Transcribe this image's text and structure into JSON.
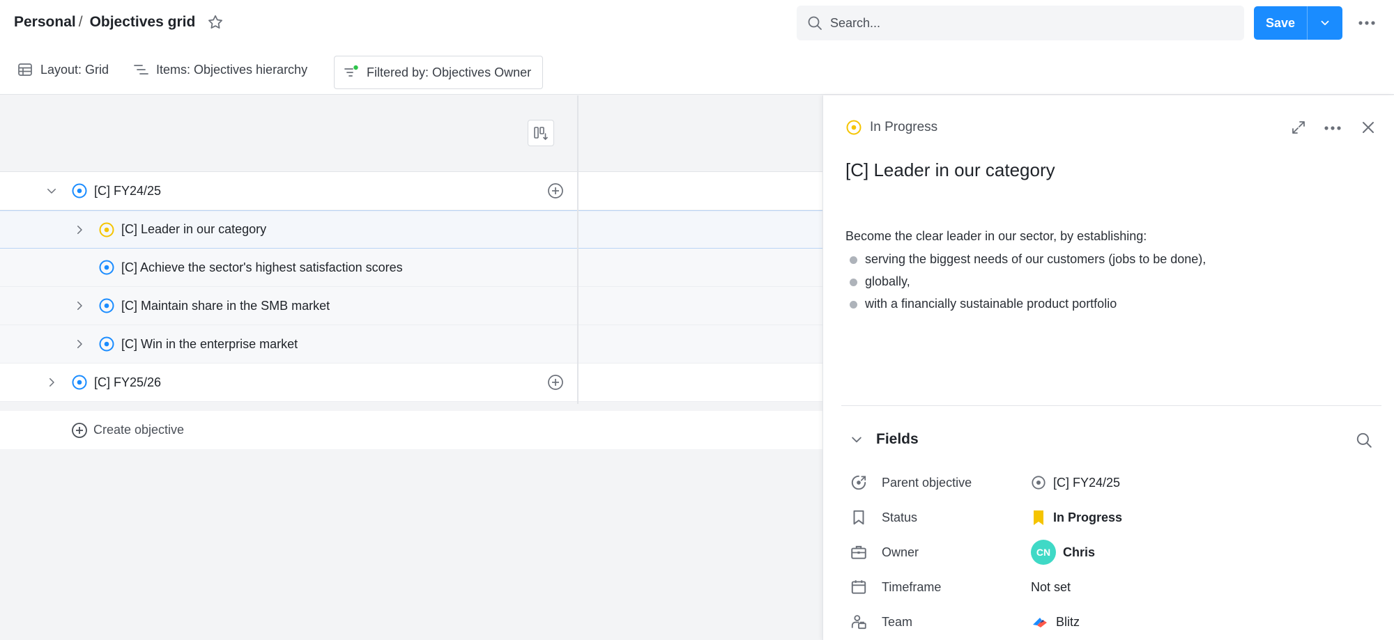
{
  "header": {
    "breadcrumb_root": "Personal",
    "breadcrumb_sep": "/",
    "page_title": "Objectives grid",
    "search_placeholder": "Search...",
    "save_label": "Save"
  },
  "toolbar": {
    "layout_label": "Layout: Grid",
    "items_label": "Items: Objectives hierarchy",
    "filter_label": "Filtered by: Objectives Owner"
  },
  "grid": {
    "rows": [
      {
        "label": "[C] FY24/25",
        "status": "in-progress-blue",
        "expanded": true
      },
      {
        "label": "[C] Leader in our category",
        "status": "in-progress-yellow",
        "expanded": false
      },
      {
        "label": "[C] Achieve the sector's highest satisfaction scores",
        "status": "in-progress-blue"
      },
      {
        "label": "[C] Maintain share in the SMB market",
        "status": "in-progress-blue",
        "expanded": false
      },
      {
        "label": "[C] Win in the enterprise market",
        "status": "in-progress-blue",
        "expanded": false
      },
      {
        "label": "[C] FY25/26",
        "status": "in-progress-blue",
        "expanded": false
      }
    ],
    "create_label": "Create objective"
  },
  "panel": {
    "status_label": "In Progress",
    "title": "[C] Leader in our category",
    "description_intro": "Become the clear leader in our sector, by establishing:",
    "description_bullets": [
      "serving the biggest needs of our customers (jobs to be done),",
      "globally,",
      "with a financially sustainable product portfolio"
    ],
    "fields_heading": "Fields",
    "fields": {
      "parent_label": "Parent objective",
      "parent_value": "[C] FY24/25",
      "status_label": "Status",
      "status_value": "In Progress",
      "owner_label": "Owner",
      "owner_initials": "CN",
      "owner_value": "Chris",
      "timeframe_label": "Timeframe",
      "timeframe_value": "Not set",
      "team_label": "Team",
      "team_value": "Blitz"
    }
  },
  "colors": {
    "accent": "#1a8cff",
    "status_blue": "#1a8cff",
    "status_yellow": "#f5c400",
    "avatar": "#3fd9c6"
  }
}
